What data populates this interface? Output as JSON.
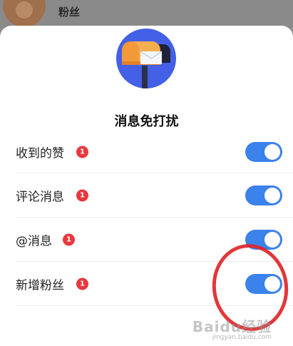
{
  "background": {
    "label": "粉丝"
  },
  "dialog": {
    "title": "消息免打扰",
    "rows": [
      {
        "label": "收到的赞",
        "badge": "1",
        "enabled": true
      },
      {
        "label": "评论消息",
        "badge": "1",
        "enabled": true
      },
      {
        "label": "@消息",
        "badge": "1",
        "enabled": true
      },
      {
        "label": "新增粉丝",
        "badge": "1",
        "enabled": true
      }
    ]
  },
  "colors": {
    "toggle_on": "#3b82ea",
    "badge": "#e8383d",
    "hero_bg": "#4460e6",
    "annotation": "#e0262a"
  },
  "icons": {
    "hero": "mailbox-icon"
  },
  "watermark": {
    "text": "Baidu经验",
    "url": "jingyan.baidu.com"
  }
}
